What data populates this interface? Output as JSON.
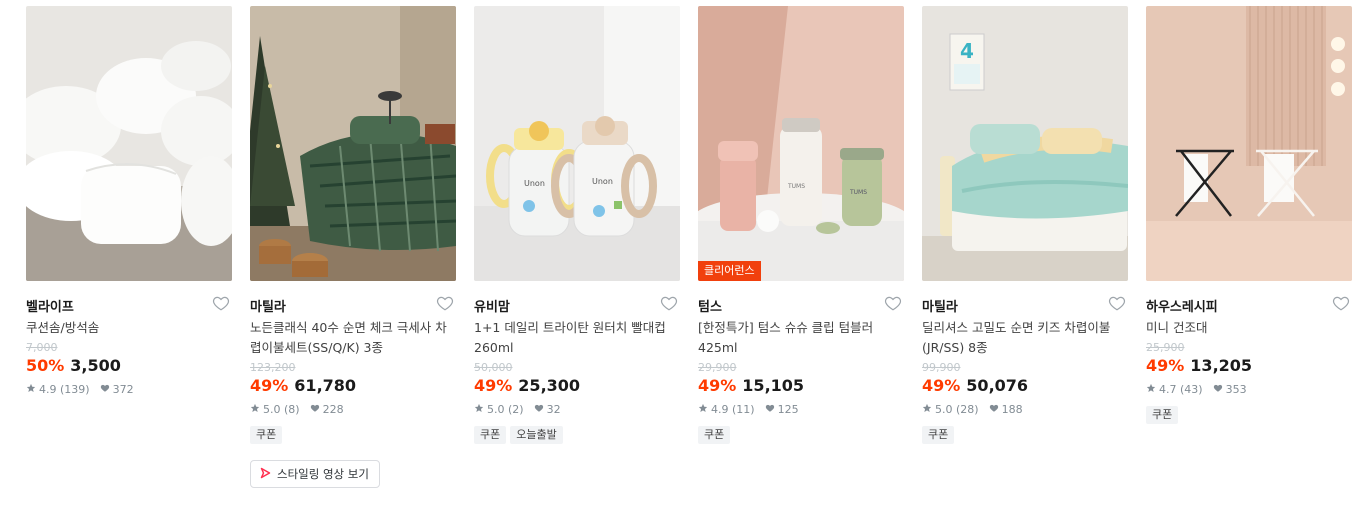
{
  "products": [
    {
      "brand": "벨라이프",
      "name": "쿠션솜/방석솜",
      "original_price": "7,000",
      "discount": "50%",
      "price": "3,500",
      "rating": "4.9 (139)",
      "likes": "372",
      "badges": [],
      "image_overlay": ""
    },
    {
      "brand": "마틸라",
      "name": "노든클래식 40수 순면 체크 극세사 차렵이불세트(SS/Q/K) 3종",
      "original_price": "123,200",
      "discount": "49%",
      "price": "61,780",
      "rating": "5.0 (8)",
      "likes": "228",
      "badges": [
        "쿠폰"
      ],
      "video_button": "스타일링 영상 보기",
      "image_overlay": ""
    },
    {
      "brand": "유비맘",
      "name": "1+1 데일리 트라이탄 원터치 빨대컵 260ml",
      "original_price": "50,000",
      "discount": "49%",
      "price": "25,300",
      "rating": "5.0 (2)",
      "likes": "32",
      "badges": [
        "쿠폰",
        "오늘출발"
      ],
      "image_overlay": ""
    },
    {
      "brand": "텀스",
      "name": "[한정특가] 텀스 슈슈 클립 텀블러 425ml",
      "original_price": "29,900",
      "discount": "49%",
      "price": "15,105",
      "rating": "4.9 (11)",
      "likes": "125",
      "badges": [
        "쿠폰"
      ],
      "image_overlay": "클리어런스"
    },
    {
      "brand": "마틸라",
      "name": "딜리셔스 고밀도 순면 키즈 차렵이불 (JR/SS) 8종",
      "original_price": "99,900",
      "discount": "49%",
      "price": "50,076",
      "rating": "5.0 (28)",
      "likes": "188",
      "badges": [
        "쿠폰"
      ],
      "image_overlay": ""
    },
    {
      "brand": "하우스레시피",
      "name": "미니 건조대",
      "original_price": "25,900",
      "discount": "49%",
      "price": "13,205",
      "rating": "4.7 (43)",
      "likes": "353",
      "badges": [
        "쿠폰"
      ],
      "image_overlay": ""
    }
  ],
  "calendar_digit": "4",
  "tumbler_logo": "TUMS",
  "cup_label": "Unon",
  "colors": {
    "discount": "#ff3b00",
    "clearance_tag": "#f1400d",
    "badge_bg": "#f1f3f5",
    "play_icon": "#ff2f4f"
  },
  "icons": [
    "heart-outline-icon",
    "star-icon",
    "heart-filled-icon",
    "play-icon"
  ]
}
